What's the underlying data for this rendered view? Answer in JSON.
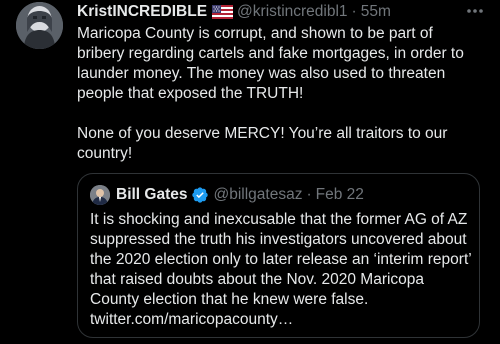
{
  "tweet": {
    "display_name": "KristINCREDIBLE",
    "flag_icon": "us-flag-icon",
    "handle": "@kristincredibl1",
    "separator": "·",
    "time": "55m",
    "body_paragraphs": [
      "Maricopa County is corrupt, and shown to be part of bribery regarding cartels and fake mortgages, in order to launder money. The money was also used to threaten people that exposed the TRUTH!",
      "None of you deserve MERCY! You’re all traitors to our country!"
    ]
  },
  "quoted_tweet": {
    "display_name": "Bill Gates",
    "verified_icon": "verified-badge-icon",
    "handle": "@billgatesaz",
    "separator": "·",
    "date": "Feb 22",
    "text": "It is shocking and inexcusable that the former AG of AZ suppressed the truth his investigators uncovered about the 2020 election only to later release an ‘interim report’ that raised doubts about the Nov. 2020 Maricopa County election that he knew were false.",
    "link": "twitter.com/maricopacounty…"
  },
  "colors": {
    "background": "#000000",
    "text_primary": "#e7e9ea",
    "text_secondary": "#71767b",
    "border": "#2f3336",
    "verified": "#1d9bf0"
  }
}
